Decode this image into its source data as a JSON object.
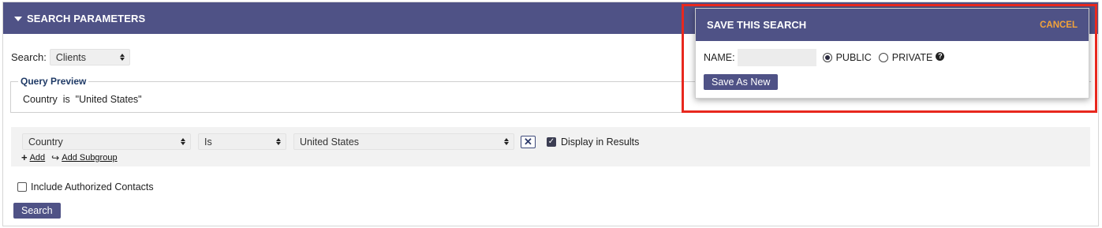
{
  "panel": {
    "title": "SEARCH PARAMETERS"
  },
  "search": {
    "label": "Search:",
    "selected": "Clients"
  },
  "query_preview": {
    "legend": "Query Preview",
    "text": "Country  is  \"United States\""
  },
  "criteria": {
    "field": "Country",
    "operator": "Is",
    "value": "United States",
    "remove_icon": "close-x-icon",
    "display_in_results_label": "Display in Results",
    "display_in_results_checked": true,
    "add_label": "Add",
    "add_subgroup_label": "Add Subgroup"
  },
  "include_authorized": {
    "label": "Include Authorized Contacts",
    "checked": false
  },
  "search_button": "Search",
  "save_popup": {
    "title": "SAVE THIS SEARCH",
    "cancel": "CANCEL",
    "name_label": "NAME:",
    "name_value": "",
    "public_label": "PUBLIC",
    "private_label": "PRIVATE",
    "visibility": "public",
    "save_button": "Save As New"
  },
  "colors": {
    "header_bg": "#4f5286",
    "cancel": "#f2a33a",
    "highlight": "#e8281e",
    "legend": "#1f3a66"
  }
}
